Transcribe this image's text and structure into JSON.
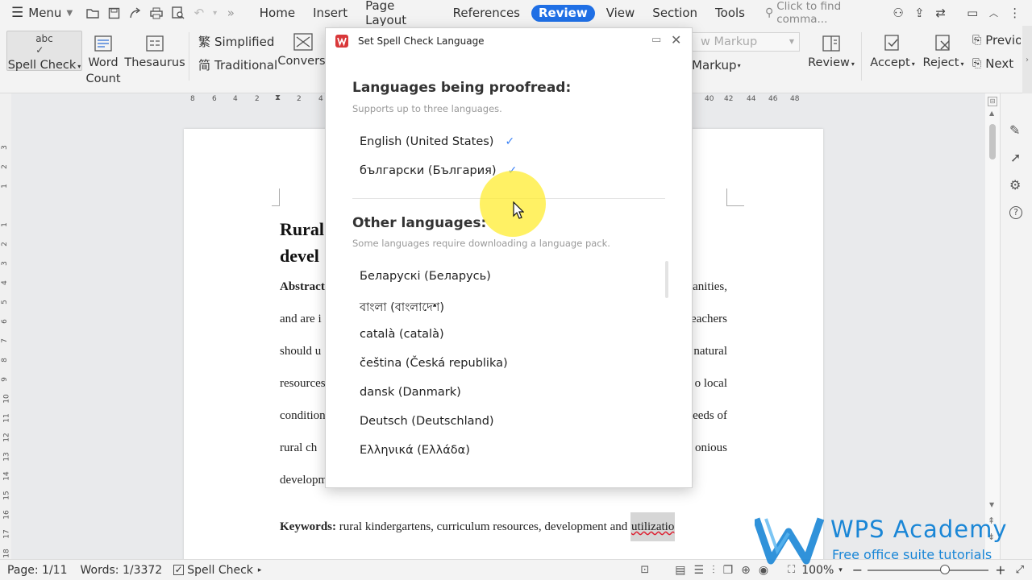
{
  "menubar": {
    "menu_label": "Menu",
    "tabs": [
      "Home",
      "Insert",
      "Page Layout",
      "References",
      "Review",
      "View",
      "Section",
      "Tools"
    ],
    "active_tab": "Review",
    "search_placeholder": "Click to find comma..."
  },
  "ribbon": {
    "spell_check": "Spell Check",
    "word": "Word",
    "count": "Count",
    "thesaurus": "Thesaurus",
    "simplified": "Simplified",
    "traditional": "Traditional",
    "conversion": "Conversi",
    "markup_select": "w Markup",
    "markup": "Markup",
    "review": "Review",
    "accept": "Accept",
    "reject": "Reject",
    "previous": "Previo",
    "next": "Next"
  },
  "ruler": {
    "left_ticks": [
      "8",
      "6",
      "4",
      "2",
      "2",
      "4"
    ],
    "right_ticks": [
      "40",
      "42",
      "44",
      "46",
      "48"
    ]
  },
  "vruler": {
    "ticks": [
      "3",
      "2",
      "1",
      "1",
      "2",
      "3",
      "4",
      "5",
      "6",
      "7",
      "8",
      "9",
      "10",
      "11",
      "12",
      "13",
      "14",
      "15",
      "16",
      "17",
      "18"
    ]
  },
  "document": {
    "title_line1": "Rural",
    "title_line2": "devel",
    "abstract_label": "Abstract",
    "left_fragments": [
      "and are i",
      "should u",
      "resources",
      "condition",
      "rural ch",
      "developm"
    ],
    "right_fragments": [
      "anities,",
      "eachers",
      "natural",
      "o local",
      "eeds of",
      "onious"
    ],
    "keywords_label": "Keywords:",
    "keywords_text": "rural kindergartens, curriculum resources, development and",
    "keywords_tail": "utilizatio"
  },
  "dialog": {
    "title": "Set Spell Check Language",
    "proofread_heading": "Languages being proofread:",
    "proofread_sub": "Supports up to three languages.",
    "proofread_langs": [
      "English (United States)",
      "български (България)"
    ],
    "other_heading": "Other languages:",
    "other_sub": "Some languages require downloading a language pack.",
    "other_langs": [
      "Беларускі (Беларусь)",
      "বাংলা (বাংলাদেশ)",
      "català (català)",
      "čeština (Česká republika)",
      "dansk (Danmark)",
      "Deutsch (Deutschland)",
      "Ελληνικά (Ελλάδα)"
    ]
  },
  "status": {
    "page": "Page: 1/11",
    "words": "Words: 1/3372",
    "spell_check": "Spell Check",
    "zoom": "100%"
  },
  "watermark": {
    "title": "WPS Academy",
    "subtitle": "Free office suite tutorials"
  },
  "colors": {
    "accent": "#1f6fe5",
    "check": "#3b82f6",
    "cursor_highlight": "#ffec28",
    "wps_logo": "#d9383a",
    "watermark": "#1a86d6"
  }
}
